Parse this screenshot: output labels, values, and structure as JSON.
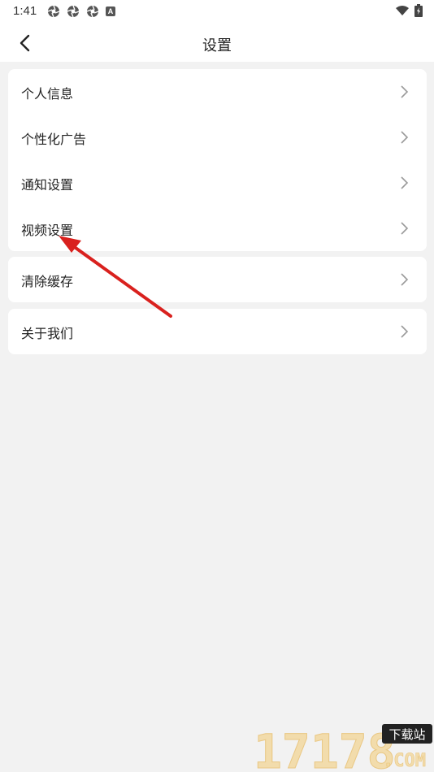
{
  "status": {
    "time": "1:41",
    "left_icons": [
      "aperture-icon",
      "aperture-icon",
      "aperture-icon",
      "a-badge-icon"
    ],
    "a_badge": "A",
    "right_icons": [
      "wifi-icon",
      "battery-icon"
    ]
  },
  "header": {
    "title": "设置",
    "back_icon": "chevron-left-icon"
  },
  "groups": [
    {
      "items": [
        {
          "label": "个人信息",
          "icon": "chevron-right-icon"
        },
        {
          "label": "个性化广告",
          "icon": "chevron-right-icon"
        },
        {
          "label": "通知设置",
          "icon": "chevron-right-icon"
        },
        {
          "label": "视频设置",
          "icon": "chevron-right-icon"
        }
      ]
    },
    {
      "items": [
        {
          "label": "清除缓存",
          "icon": "chevron-right-icon"
        }
      ]
    },
    {
      "items": [
        {
          "label": "关于我们",
          "icon": "chevron-right-icon"
        }
      ]
    }
  ],
  "annotation": {
    "color": "#d9211e"
  },
  "watermark": {
    "brand": "17178",
    "tag": "下载站",
    "domain": ".COM"
  },
  "colors": {
    "background": "#f2f2f2",
    "card": "#ffffff",
    "chevron": "#9a9a9a"
  }
}
